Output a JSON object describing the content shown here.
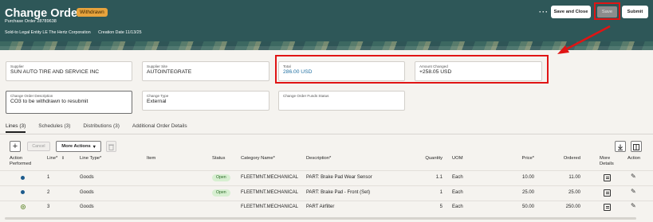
{
  "header": {
    "title": "Change Order 3",
    "badge": "Withdrawn",
    "subtitle": "Purchase Order 28789638",
    "sold_to": "Sold-to Legal Entity LE The Hertz Corporation",
    "creation_date": "Creation Date 11/13/25",
    "more_label": "···",
    "save_close_label": "Save and Close",
    "save_label": "Save",
    "submit_label": "Submit"
  },
  "fields": {
    "supplier": {
      "label": "Supplier",
      "value": "SUN AUTO TIRE AND SERVICE INC"
    },
    "supplier_site": {
      "label": "Supplier Site",
      "value": "AUTOINTEGRATE"
    },
    "total": {
      "label": "Total",
      "value": "286.00 USD"
    },
    "amount_changed": {
      "label": "Amount Changed",
      "value": "+258.05 USD"
    },
    "description": {
      "label": "Change Order Description",
      "value": "CO3 to be withdrawn to resubmit"
    },
    "change_type": {
      "label": "Change Type",
      "value": "External"
    },
    "funds_status": {
      "label": "Change Order Funds Status",
      "value": ""
    }
  },
  "tabs": [
    {
      "label": "Lines (3)"
    },
    {
      "label": "Schedules (3)"
    },
    {
      "label": "Distributions (3)"
    },
    {
      "label": "Additional Order Details"
    }
  ],
  "toolbar": {
    "add_label": "+",
    "cancel_label": "Cancel",
    "more_actions_label": "More Actions"
  },
  "table": {
    "headers": {
      "action_performed": "Action Performed",
      "line": "Line*",
      "line_type": "Line Type*",
      "item": "Item",
      "status": "Status",
      "category": "Category Name*",
      "description": "Description*",
      "quantity": "Quantity",
      "uom": "UOM",
      "price": "Price*",
      "ordered": "Ordered",
      "more_details": "More Details",
      "action": "Action"
    },
    "rows": [
      {
        "line": "1",
        "line_type": "Goods",
        "status": "Open",
        "category": "FLEETMNT.MECHANICAL",
        "description": "PART: Brake Pad Wear Sensor",
        "quantity": "1.1",
        "uom": "Each",
        "price": "10.00",
        "ordered": "11.00"
      },
      {
        "line": "2",
        "line_type": "Goods",
        "status": "Open",
        "category": "FLEETMNT.MECHANICAL",
        "description": "PART: Brake Pad - Front (Set)",
        "quantity": "1",
        "uom": "Each",
        "price": "25.00",
        "ordered": "25.00"
      },
      {
        "line": "3",
        "line_type": "Goods",
        "status": "",
        "category": "FLEETMNT.MECHANICAL",
        "description": "PART Airfilter",
        "quantity": "5",
        "uom": "Each",
        "price": "50.00",
        "ordered": "250.00"
      }
    ]
  },
  "colors": {
    "header_bg": "#2e5758",
    "badge_bg": "#e8a33d",
    "annotation_red": "#e01414",
    "link_blue": "#1f6fa1"
  }
}
